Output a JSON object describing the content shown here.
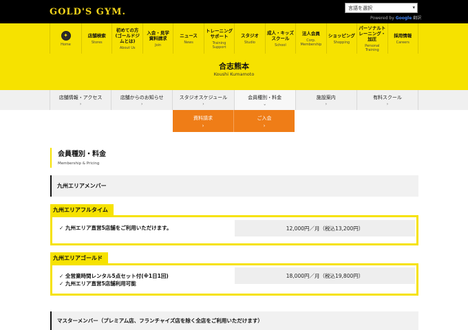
{
  "header": {
    "logo_text": "GOLD'S GYM.",
    "language_select": {
      "value": "言語を選択"
    },
    "powered_by": {
      "prefix": "Powered by ",
      "brand": "Google",
      "suffix": " 翻訳"
    }
  },
  "nav": {
    "items": [
      {
        "jp": "",
        "en": "Home",
        "icon": "home-emblem-icon"
      },
      {
        "jp": "店舗検索",
        "en": "Stores"
      },
      {
        "jp": "初めての方\n(ゴールドジ\nムとは)",
        "en": "About Us"
      },
      {
        "jp": "入会・見学\n資料請求",
        "en": "Join"
      },
      {
        "jp": "ニュース",
        "en": "News"
      },
      {
        "jp": "トレーニング\nサポート",
        "en": "Training\nSupport"
      },
      {
        "jp": "スタジオ",
        "en": "Studio"
      },
      {
        "jp": "成人・キッズ\nスクール",
        "en": "School"
      },
      {
        "jp": "法人会員",
        "en": "Corp.\nMembership"
      },
      {
        "jp": "ショッピング",
        "en": "Shopping"
      },
      {
        "jp": "パーソナルト\nレーニング・\n加圧",
        "en": "Personal\nTraining"
      },
      {
        "jp": "採用情報",
        "en": "Careers"
      }
    ]
  },
  "store": {
    "title": "合志熊本",
    "subtitle": "Koushi Kumamoto"
  },
  "subnav": {
    "items": [
      {
        "label": "店舗情報・アクセス"
      },
      {
        "label": "店舗からのお知らせ"
      },
      {
        "label": "スタジオスケジュール"
      },
      {
        "label": "会員種別・料金"
      },
      {
        "label": "施設案内"
      },
      {
        "label": "有料スクール"
      }
    ],
    "buttons": [
      {
        "label": "資料請求"
      },
      {
        "label": "ご入会"
      }
    ]
  },
  "section": {
    "title": "会員種別・料金",
    "subtitle": "Membership & Pricing"
  },
  "membership_groups": {
    "kyushu": "九州エリアメンバー",
    "master": "マスターメンバー（プレミアム店、フランチャイズ店を除く全店をご利用いただけます）"
  },
  "plans": [
    {
      "name": "九州エリアフルタイム",
      "features": [
        "九州エリア直営5店舗をご利用いただけます。"
      ],
      "price": "12,000円／月（税込13,200円）"
    },
    {
      "name": "九州エリアゴールド",
      "features": [
        "全営業時間レンタル5点セット付(※1日1回)",
        "九州エリア直営5店舗利用可能"
      ],
      "price": "18,000円／月（税込19,800円）"
    }
  ],
  "colors": {
    "brand_yellow": "#f6e200",
    "accent_orange": "#ef7d17",
    "header_black": "#000000"
  }
}
